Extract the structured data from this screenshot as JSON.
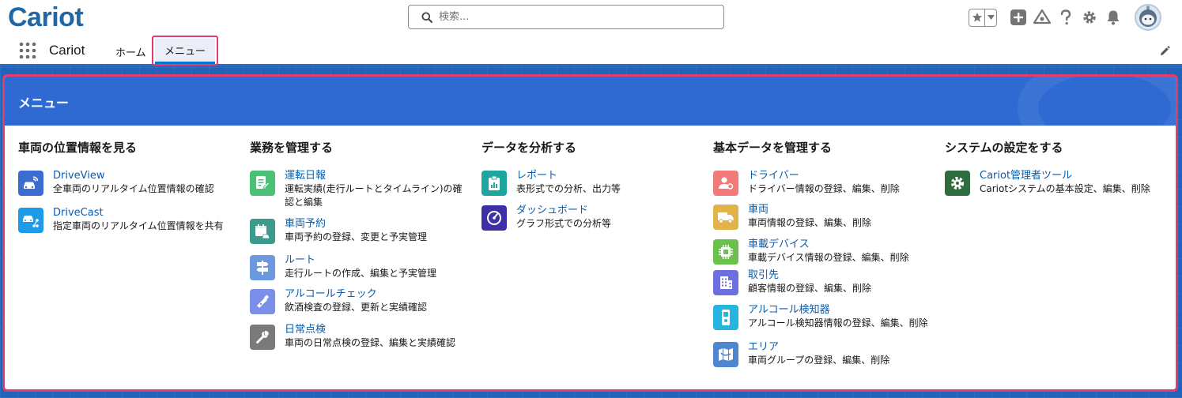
{
  "header": {
    "logo_text": "Cariot",
    "search_placeholder": "検索...",
    "colors": {
      "logo": "#2167a3",
      "brand_blue": "#2e6ad2",
      "highlight": "#e03c6e"
    }
  },
  "nav": {
    "app_name": "Cariot",
    "tabs": [
      {
        "label": "ホーム"
      },
      {
        "label": "メニュー",
        "active": true
      }
    ]
  },
  "card": {
    "title": "メニュー",
    "columns": [
      {
        "title": "車両の位置情報を見る",
        "items": [
          {
            "label": "DriveView",
            "desc": "全車両のリアルタイム位置情報の確認",
            "icon": "car-signal-icon",
            "color": "#3b6ccf"
          },
          {
            "label": "DriveCast",
            "desc": "指定車両のリアルタイム位置情報を共有",
            "icon": "car-share-icon",
            "color": "#1e9be8"
          }
        ]
      },
      {
        "title": "業務を管理する",
        "items": [
          {
            "label": "運転日報",
            "desc": "運転実績(走行ルートとタイムライン)の確認と編集",
            "icon": "report-edit-icon",
            "color": "#4bc076"
          },
          {
            "label": "車両予約",
            "desc": "車両予約の登録、変更と予実管理",
            "icon": "calendar-car-icon",
            "color": "#3c9b8c"
          },
          {
            "label": "ルート",
            "desc": "走行ルートの作成、編集と予実管理",
            "icon": "signpost-icon",
            "color": "#6c98e0"
          },
          {
            "label": "アルコールチェック",
            "desc": "飲酒検査の登録、更新と実績確認",
            "icon": "breath-tester-icon",
            "color": "#7b8ee8"
          },
          {
            "label": "日常点検",
            "desc": "車両の日常点検の登録、編集と実績確認",
            "icon": "wrench-icon",
            "color": "#7a7a7a"
          }
        ]
      },
      {
        "title": "データを分析する",
        "items": [
          {
            "label": "レポート",
            "desc": "表形式での分析、出力等",
            "icon": "report-icon",
            "color": "#1fa5a0"
          },
          {
            "label": "ダッシュボード",
            "desc": "グラフ形式での分析等",
            "icon": "dashboard-icon",
            "color": "#3d2fa8"
          }
        ]
      },
      {
        "title": "基本データを管理する",
        "items": [
          {
            "label": "ドライバー",
            "desc": "ドライバー情報の登録、編集、削除",
            "icon": "driver-icon",
            "color": "#f07b78"
          },
          {
            "label": "車両",
            "desc": "車両情報の登録、編集、削除",
            "icon": "truck-icon",
            "color": "#e0b44a"
          },
          {
            "label": "車載デバイス",
            "desc": "車載デバイス情報の登録、編集、削除",
            "icon": "chip-icon",
            "color": "#6cc04e"
          },
          {
            "label": "取引先",
            "desc": "顧客情報の登録、編集、削除",
            "icon": "building-icon",
            "color": "#6b6fe0"
          },
          {
            "label": "アルコール検知器",
            "desc": "アルコール検知器情報の登録、編集、削除",
            "icon": "detector-icon",
            "color": "#28b4e0"
          },
          {
            "label": "エリア",
            "desc": "車両グループの登録、編集、削除",
            "icon": "map-icon",
            "color": "#4f86d0"
          }
        ]
      },
      {
        "title": "システムの設定をする",
        "items": [
          {
            "label": "Cariot管理者ツール",
            "desc": "Cariotシステムの基本設定、編集、削除",
            "icon": "settings-gear-icon",
            "color": "#2f6b3c"
          }
        ]
      }
    ]
  }
}
